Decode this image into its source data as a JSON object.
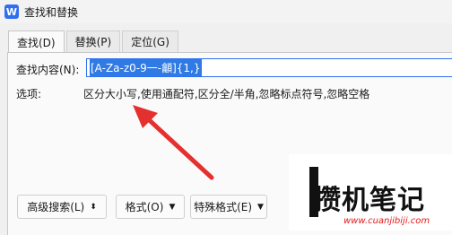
{
  "window": {
    "title": "查找和替换",
    "app_icon_letter": "W"
  },
  "tabs": [
    {
      "label": "查找(D)",
      "active": true
    },
    {
      "label": "替换(P)",
      "active": false
    },
    {
      "label": "定位(G)",
      "active": false
    }
  ],
  "find": {
    "label": "查找内容(N):",
    "value": "[A-Za-z0-9一-龥]{1,}"
  },
  "options": {
    "label": "选项:",
    "value": "区分大小写,使用通配符,区分全/半角,忽略标点符号,忽略空格"
  },
  "buttons": {
    "advanced_search": "高级搜索(L)",
    "format": "格式(O)",
    "special_format": "特殊格式(E)"
  },
  "colors": {
    "selection": "#2f7ae5",
    "arrow": "#e53030",
    "app_icon": "#2f6ff0"
  },
  "watermark": {
    "text": "攒机笔记",
    "url": "www.cuanjibiji.com"
  }
}
